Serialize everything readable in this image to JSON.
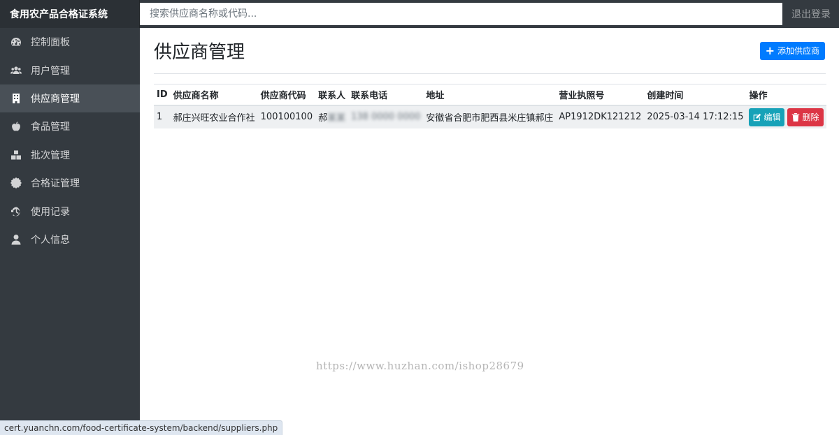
{
  "app": {
    "title": "食用农产品合格证系统",
    "logout_label": "退出登录"
  },
  "search": {
    "placeholder": "搜索供应商名称或代码..."
  },
  "sidebar": {
    "items": [
      {
        "label": "控制面板",
        "icon": "dashboard-icon",
        "active": false
      },
      {
        "label": "用户管理",
        "icon": "users-icon",
        "active": false
      },
      {
        "label": "供应商管理",
        "icon": "building-icon",
        "active": true
      },
      {
        "label": "食品管理",
        "icon": "apple-icon",
        "active": false
      },
      {
        "label": "批次管理",
        "icon": "boxes-icon",
        "active": false
      },
      {
        "label": "合格证管理",
        "icon": "certificate-icon",
        "active": false
      },
      {
        "label": "使用记录",
        "icon": "history-icon",
        "active": false
      },
      {
        "label": "个人信息",
        "icon": "user-icon",
        "active": false
      }
    ]
  },
  "main": {
    "title": "供应商管理",
    "add_button": "添加供应商"
  },
  "table": {
    "columns": [
      "ID",
      "供应商名称",
      "供应商代码",
      "联系人",
      "联系电话",
      "地址",
      "营业执照号",
      "创建时间",
      "操作"
    ],
    "rows": [
      {
        "id": "1",
        "name": "郝庄兴旺农业合作社",
        "code": "100100100",
        "contact": "郝",
        "contact_blurred": "某某",
        "phone_blurred": "138 0000 0000",
        "address": "安徽省合肥市肥西县米庄镇郝庄",
        "license": "AP1912DK121212",
        "created": "2025-03-14 17:12:15",
        "edit_label": "编辑",
        "delete_label": "删除"
      }
    ]
  },
  "watermark": "https://www.huzhan.com/ishop28679",
  "statusbar": "cert.yuanchn.com/food-certificate-system/backend/suppliers.php",
  "colors": {
    "sidebar": "#343a40",
    "active_item": "#495057",
    "primary": "#007bff",
    "info": "#17a2b8",
    "danger": "#dc3545"
  }
}
